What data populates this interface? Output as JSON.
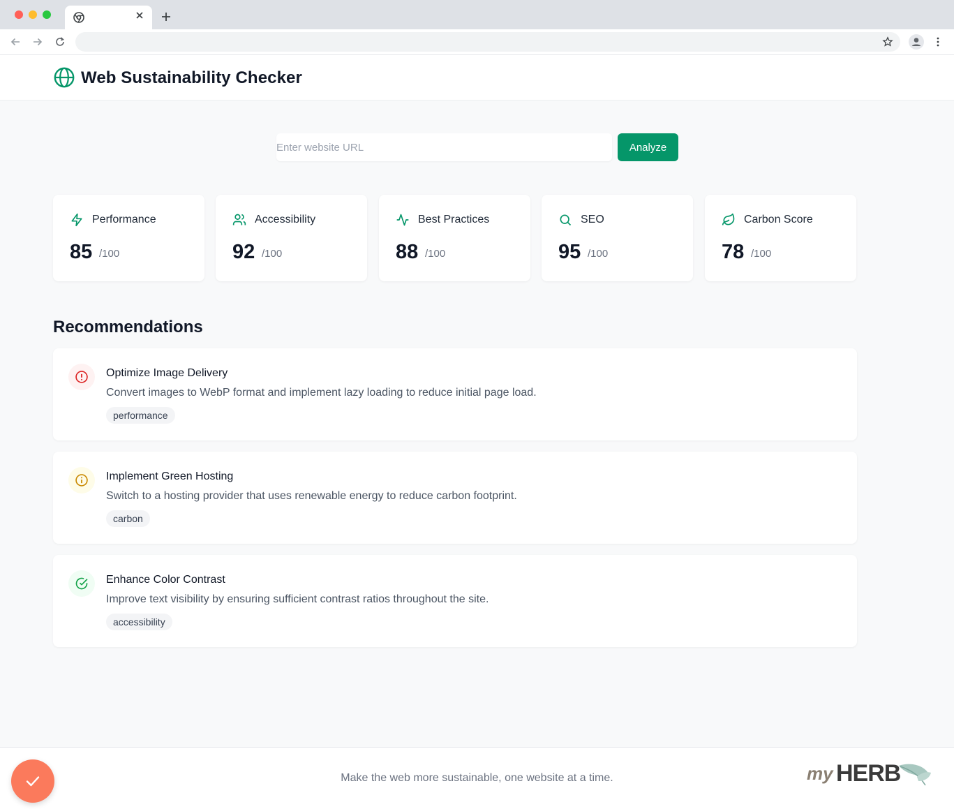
{
  "browser": {
    "tab_title": "",
    "address_url": ""
  },
  "header": {
    "title": "Web Sustainability Checker",
    "logo_icon": "globe-icon"
  },
  "search": {
    "placeholder": "Enter website URL",
    "value": "",
    "button_label": "Analyze"
  },
  "scores": [
    {
      "label": "Performance",
      "score": "85",
      "max": "/100",
      "icon": "zap-icon"
    },
    {
      "label": "Accessibility",
      "score": "92",
      "max": "/100",
      "icon": "users-icon"
    },
    {
      "label": "Best Practices",
      "score": "88",
      "max": "/100",
      "icon": "activity-icon"
    },
    {
      "label": "SEO",
      "score": "95",
      "max": "/100",
      "icon": "search-icon"
    },
    {
      "label": "Carbon Score",
      "score": "78",
      "max": "/100",
      "icon": "leaf-icon"
    }
  ],
  "recommendations": {
    "heading": "Recommendations",
    "items": [
      {
        "title": "Optimize Image Delivery",
        "description": "Convert images to WebP format and implement lazy loading to reduce initial page load.",
        "tag": "performance",
        "icon": "alert-circle-icon",
        "status_color": "#dc2626"
      },
      {
        "title": "Implement Green Hosting",
        "description": "Switch to a hosting provider that uses renewable energy to reduce carbon footprint.",
        "tag": "carbon",
        "icon": "info-icon",
        "status_color": "#ca8a04"
      },
      {
        "title": "Enhance Color Contrast",
        "description": "Improve text visibility by ensuring sufficient contrast ratios throughout the site.",
        "tag": "accessibility",
        "icon": "check-circle-icon",
        "status_color": "#16a34a"
      }
    ]
  },
  "footer": {
    "tagline": "Make the web more sustainable, one website at a time.",
    "brand": "myHERB"
  },
  "colors": {
    "accent": "#059669",
    "background": "#f8f9fa",
    "fab": "#fb7a5c"
  }
}
